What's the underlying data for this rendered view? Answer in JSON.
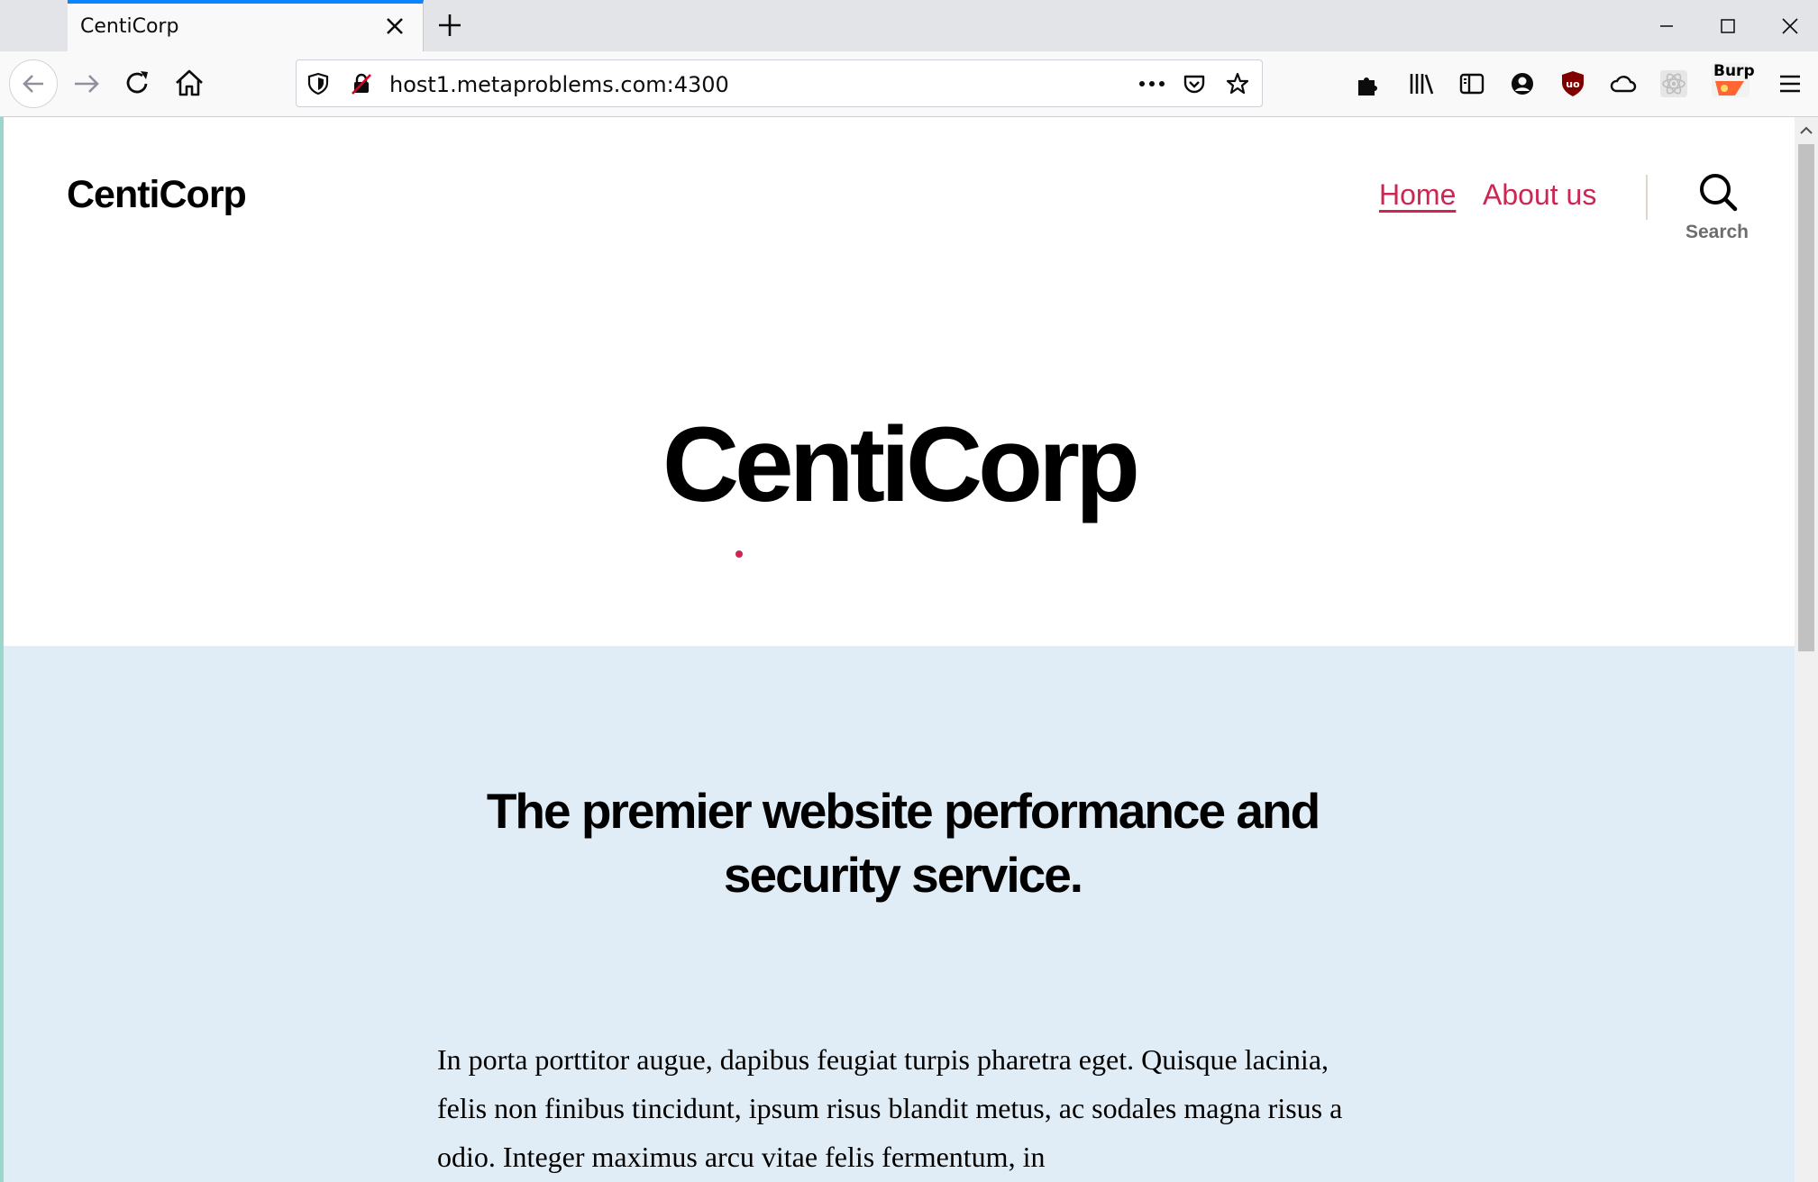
{
  "browser": {
    "tab_title": "CentiCorp",
    "url": "host1.metaproblems.com:4300",
    "burp_label": "Burp",
    "accent": "#0a84ff"
  },
  "site": {
    "title": "CentiCorp",
    "nav": [
      {
        "label": "Home",
        "active": true
      },
      {
        "label": "About us",
        "active": false
      }
    ],
    "search_label": "Search",
    "link_color": "#cd2653"
  },
  "hero": {
    "title": "CentiCorp"
  },
  "content": {
    "tagline": "The premier website performance and security service.",
    "body": "In porta porttitor augue, dapibus feugiat turpis pharetra eget. Quisque lacinia, felis non finibus tincidunt, ipsum risus blandit metus, ac sodales magna risus a odio. Integer maximus arcu vitae felis fermentum, in",
    "band_color": "#e1edf6"
  }
}
